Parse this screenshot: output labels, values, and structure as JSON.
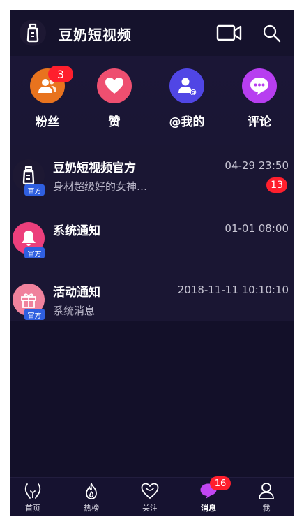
{
  "header": {
    "title": "豆奶短视频",
    "logo_icon": "baby-bottle-icon",
    "video_icon": "video-camera-icon",
    "search_icon": "search-icon"
  },
  "categories": [
    {
      "label": "粉丝",
      "icon": "fans-icon",
      "color": "#e8731e",
      "badge": "3"
    },
    {
      "label": "赞",
      "icon": "heart-icon",
      "color": "#ee4f70",
      "badge": ""
    },
    {
      "label": "@我的",
      "icon": "mention-icon",
      "color": "#5046e5",
      "badge": ""
    },
    {
      "label": "评论",
      "icon": "comment-icon",
      "color": "#b73ef0",
      "badge": ""
    }
  ],
  "messages": [
    {
      "name": "豆奶短视频官方",
      "time": "04-29 23:50",
      "preview": "身材超级好的女神…",
      "count": "13",
      "tag": "官方",
      "icon": "baby-bottle-icon"
    },
    {
      "name": "系统通知",
      "time": "01-01 08:00",
      "preview": "",
      "count": "",
      "tag": "官方",
      "icon": "bell-icon"
    },
    {
      "name": "活动通知",
      "time": "2018-11-11 10:10:10",
      "preview": "系统消息",
      "count": "",
      "tag": "官方",
      "icon": "gift-icon"
    }
  ],
  "tabbar": {
    "items": [
      {
        "label": "首页",
        "icon": "home-icon"
      },
      {
        "label": "热榜",
        "icon": "flame-icon"
      },
      {
        "label": "关注",
        "icon": "heart-outline-icon"
      },
      {
        "label": "消息",
        "icon": "message-icon",
        "badge": "16",
        "active": true
      },
      {
        "label": "我",
        "icon": "profile-icon"
      }
    ]
  },
  "colors": {
    "background": "#131029",
    "badge_red": "#ff1f2d",
    "official_blue": "#2f5fe0"
  }
}
